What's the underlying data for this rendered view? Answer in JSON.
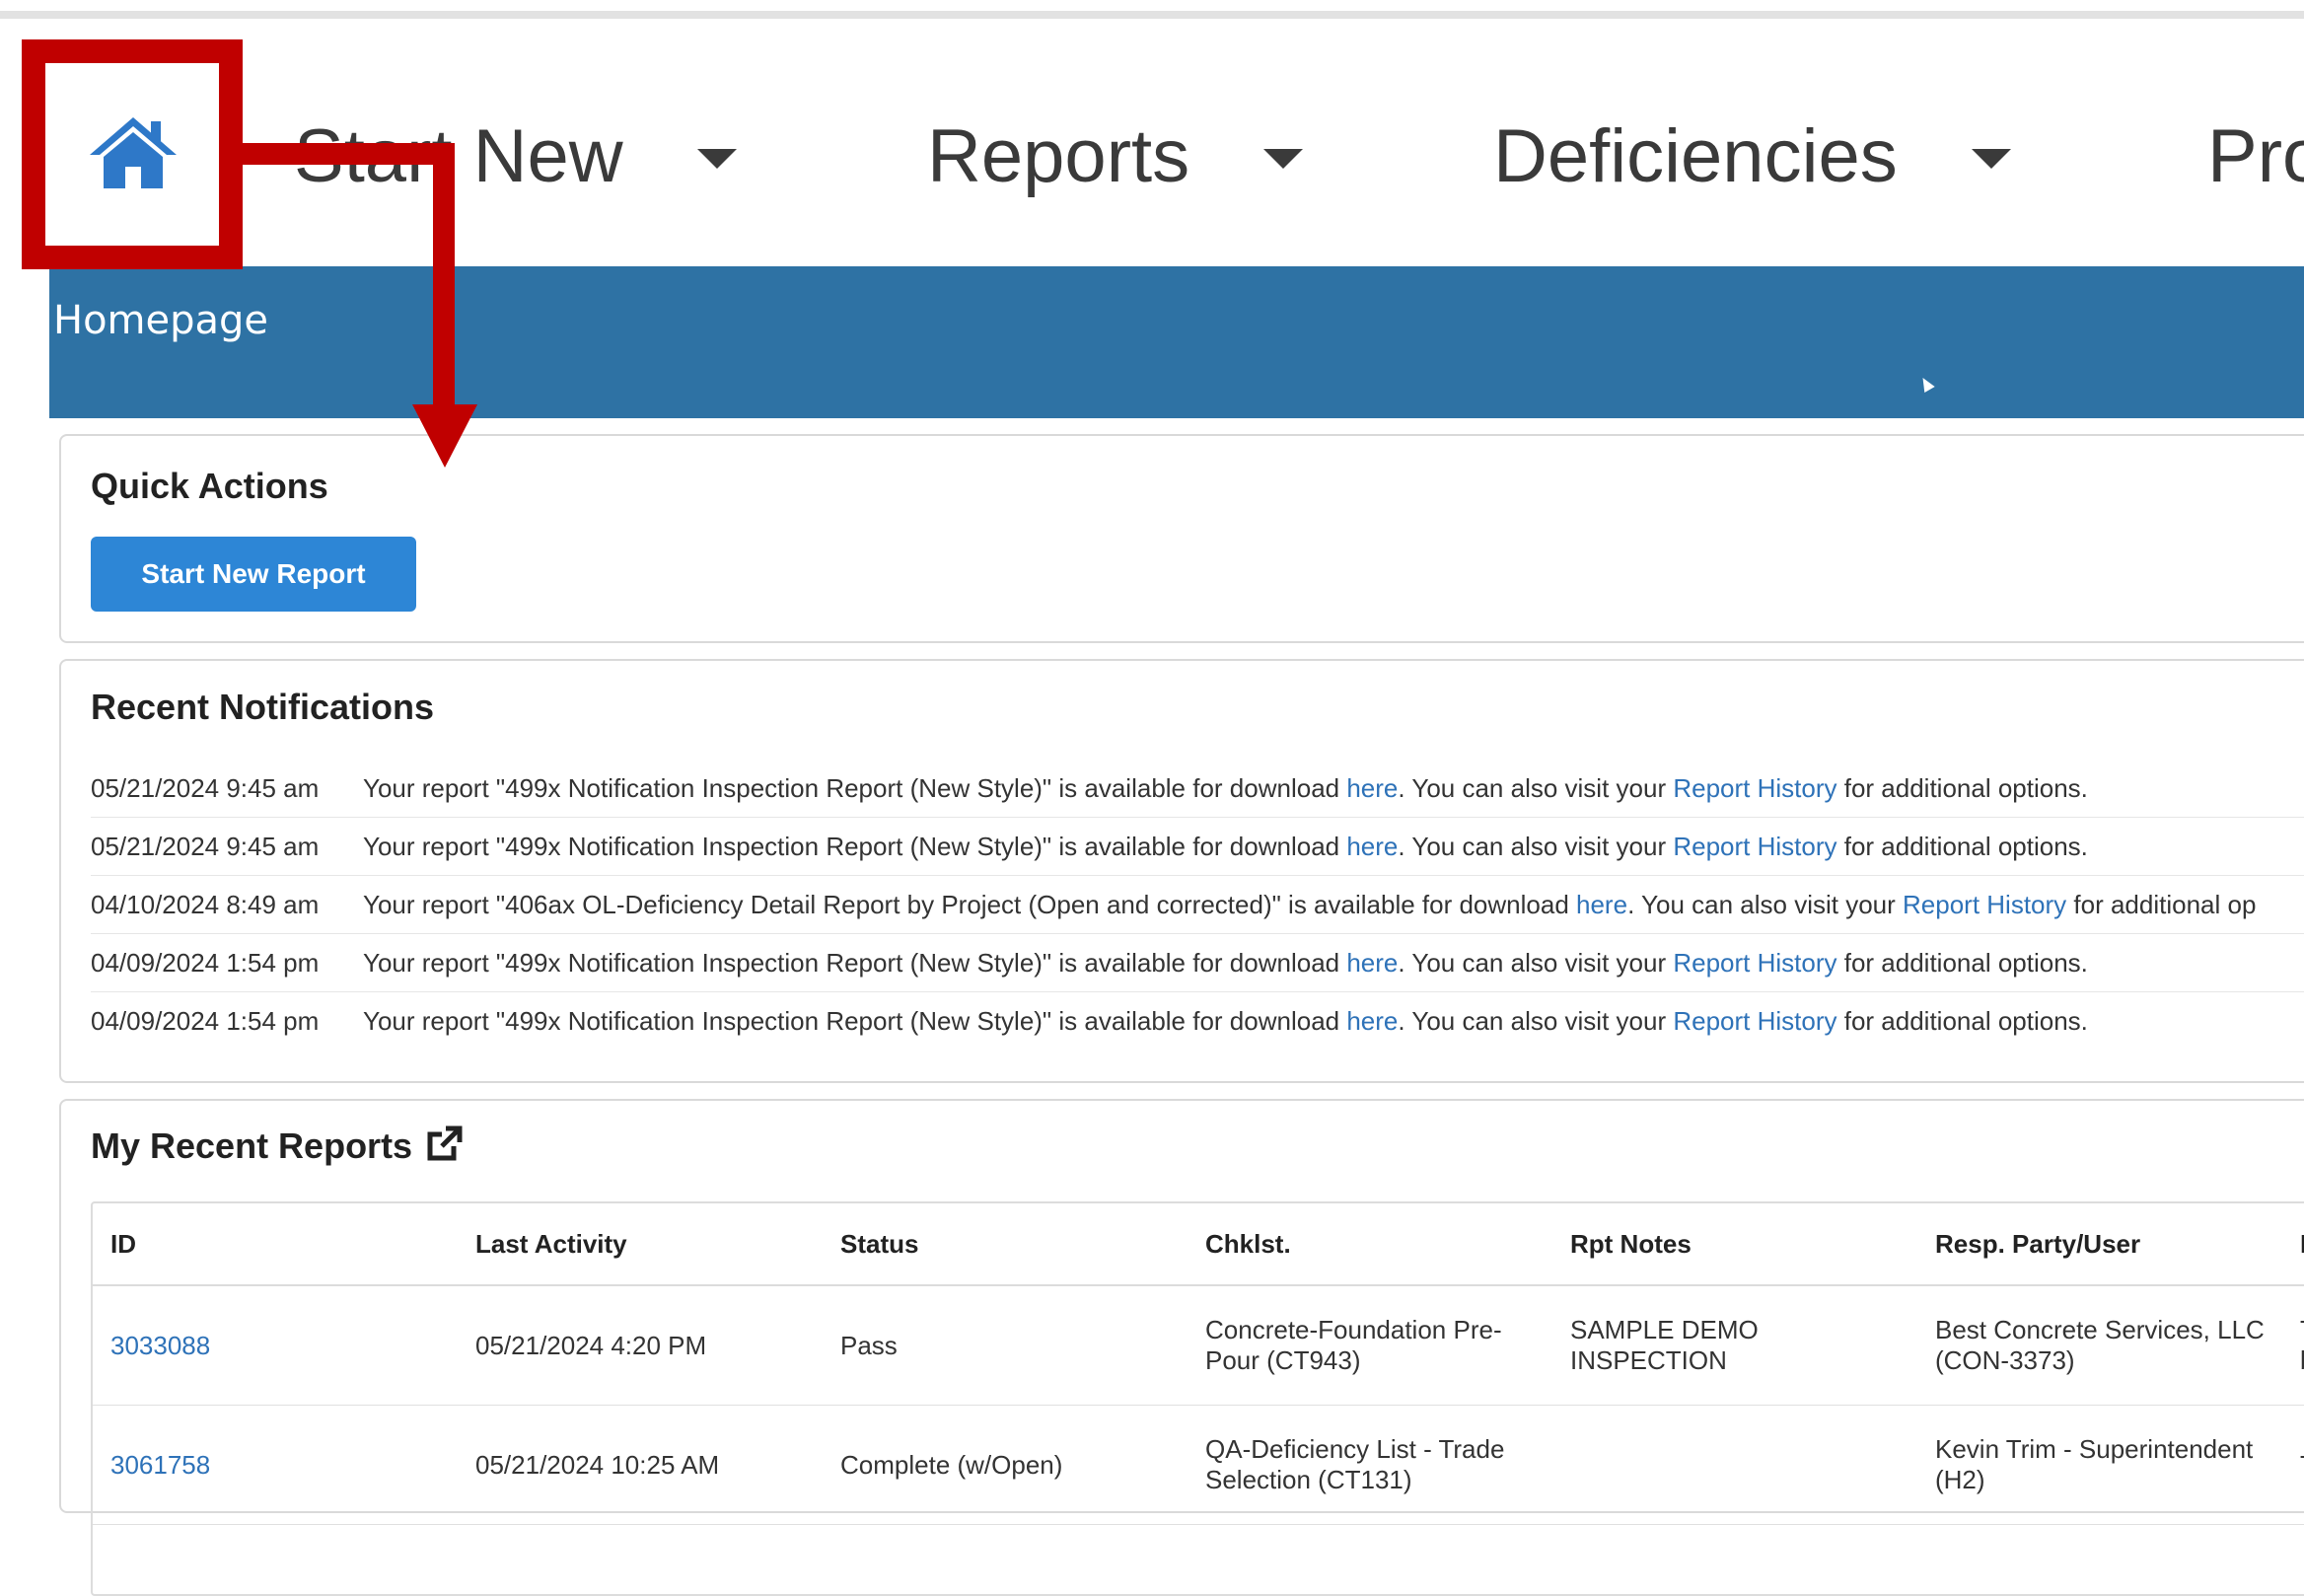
{
  "nav": {
    "home_icon": "home-icon",
    "items": [
      {
        "label": "Start New"
      },
      {
        "label": "Reports"
      },
      {
        "label": "Deficiencies"
      },
      {
        "label": "Pro"
      }
    ]
  },
  "banner": {
    "title": "Homepage"
  },
  "quick_actions": {
    "title": "Quick Actions",
    "button_label": "Start New Report"
  },
  "notifications": {
    "title": "Recent Notifications",
    "items": [
      {
        "time": "05/21/2024 9:45 am",
        "pre": "Your report \"499x Notification Inspection Report (New Style)\" is available for download ",
        "link1": "here",
        "mid": ". You can also visit your ",
        "link2": "Report History",
        "post": " for additional options."
      },
      {
        "time": "05/21/2024 9:45 am",
        "pre": "Your report \"499x Notification Inspection Report (New Style)\" is available for download ",
        "link1": "here",
        "mid": ". You can also visit your ",
        "link2": "Report History",
        "post": " for additional options."
      },
      {
        "time": "04/10/2024 8:49 am",
        "pre": "Your report \"406ax OL-Deficiency Detail Report by Project (Open and corrected)\" is available for download ",
        "link1": "here",
        "mid": ". You can also visit your ",
        "link2": "Report History",
        "post": " for additional op"
      },
      {
        "time": "04/09/2024 1:54 pm",
        "pre": "Your report \"499x Notification Inspection Report (New Style)\" is available for download ",
        "link1": "here",
        "mid": ". You can also visit your ",
        "link2": "Report History",
        "post": " for additional options."
      },
      {
        "time": "04/09/2024 1:54 pm",
        "pre": "Your report \"499x Notification Inspection Report (New Style)\" is available for download ",
        "link1": "here",
        "mid": ". You can also visit your ",
        "link2": "Report History",
        "post": " for additional options."
      }
    ]
  },
  "recent_reports": {
    "title": "My Recent Reports",
    "icon": "external-link-icon",
    "columns": [
      "ID",
      "Last Activity",
      "Status",
      "Chklst.",
      "Rpt Notes",
      "Resp. Party/User",
      "F"
    ],
    "rows": [
      {
        "id": "3033088",
        "last_activity": "05/21/2024 4:20 PM",
        "status": "Pass",
        "checklist": "Concrete-Foundation Pre-Pour (CT943)",
        "notes": "SAMPLE DEMO INSPECTION",
        "resp": "Best Concrete Services, LLC (CON-3373)",
        "extra": "T C b"
      },
      {
        "id": "3061758",
        "last_activity": "05/21/2024 10:25 AM",
        "status": "Complete (w/Open)",
        "checklist": "QA-Deficiency List - Trade Selection (CT131)",
        "notes": "",
        "resp": "Kevin Trim - Superintendent (H2)",
        "extra": "T C"
      }
    ]
  },
  "colors": {
    "banner": "#2e72a4",
    "primary_button": "#2d86d6",
    "link": "#2e72b8",
    "annotation": "#c00000"
  }
}
